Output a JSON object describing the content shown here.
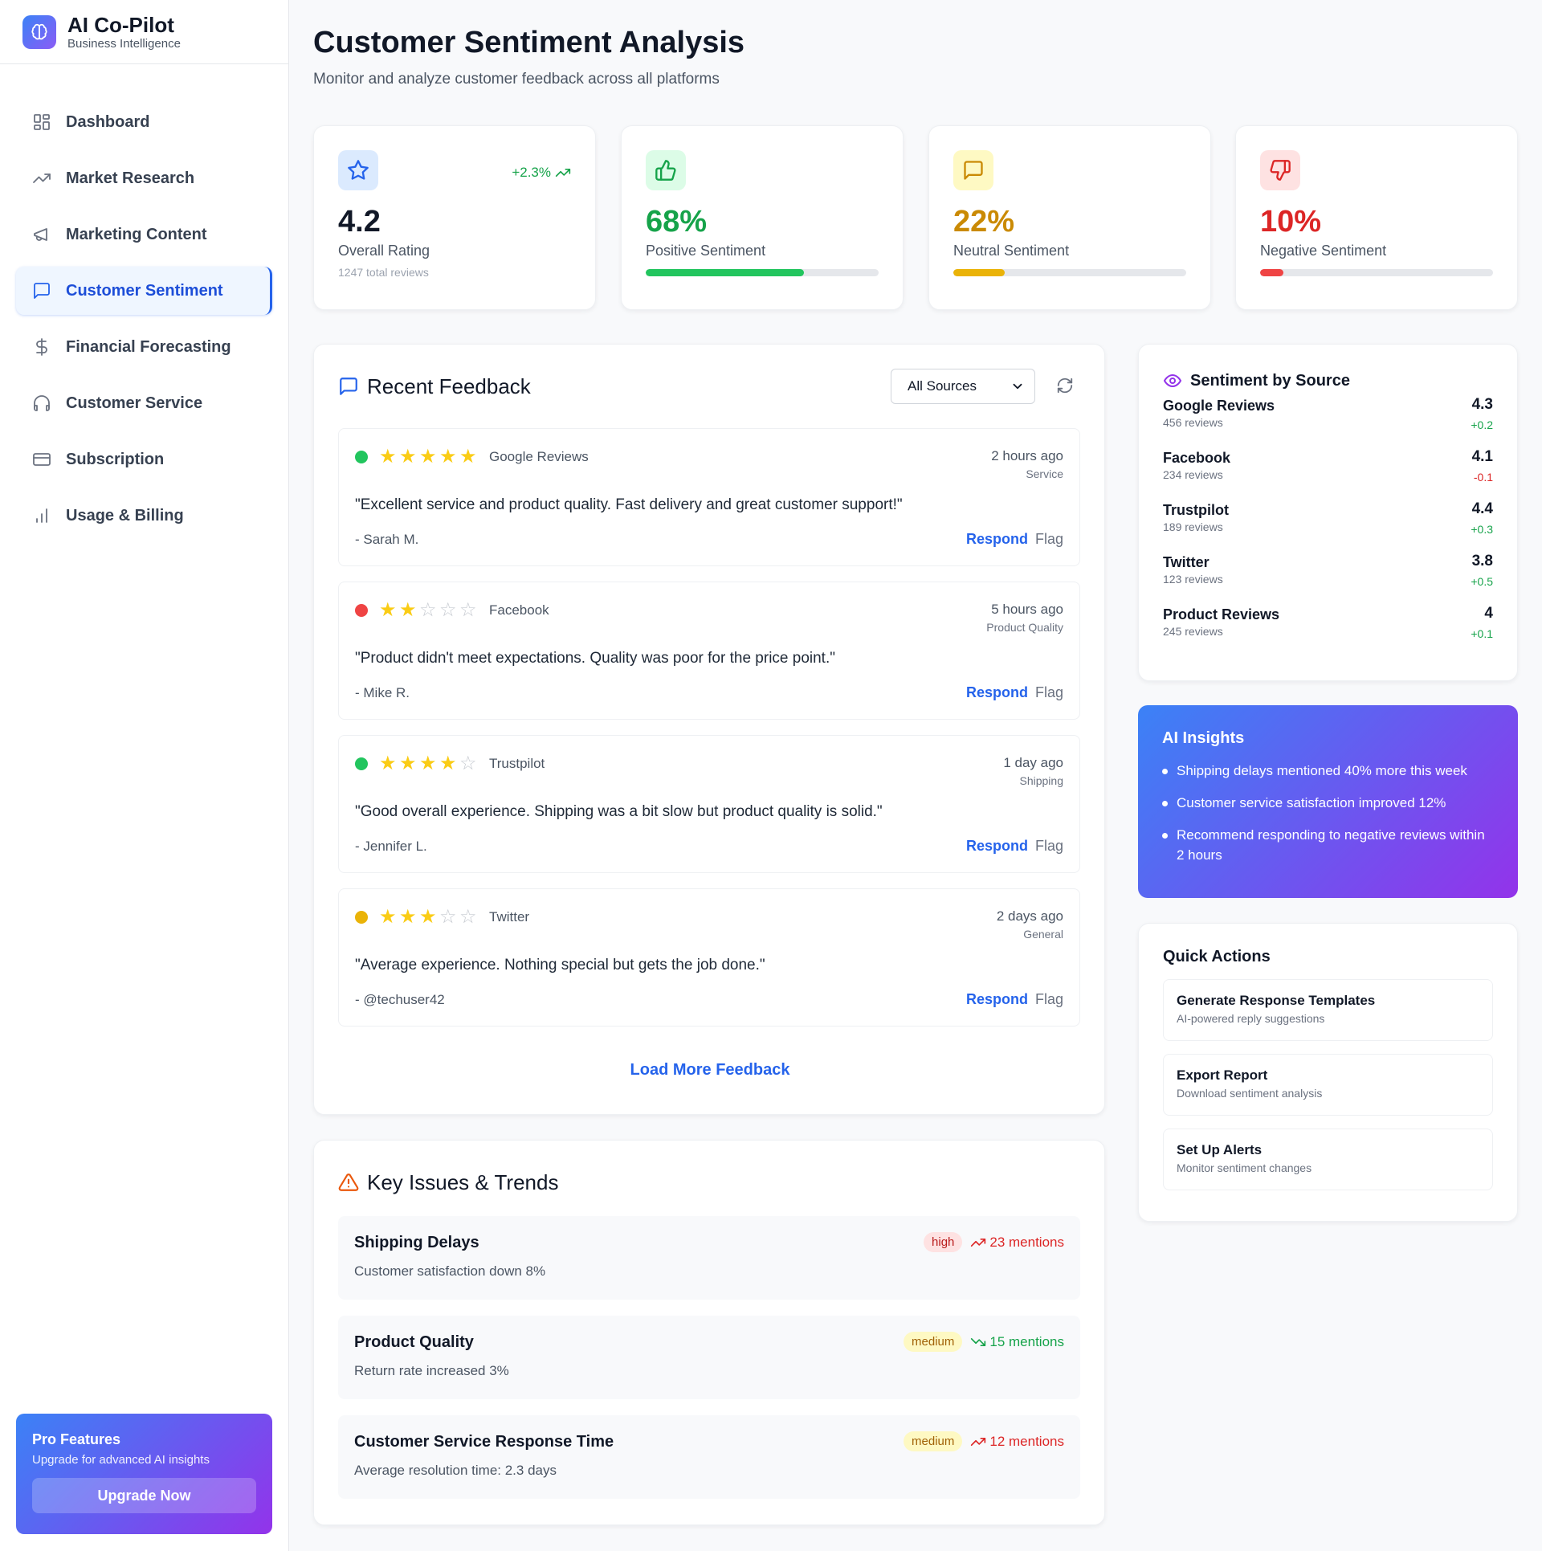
{
  "app": {
    "title": "AI Co-Pilot",
    "subtitle": "Business Intelligence"
  },
  "sidebar": {
    "items": [
      {
        "label": "Dashboard",
        "icon": "grid-icon"
      },
      {
        "label": "Market Research",
        "icon": "trending-up-icon"
      },
      {
        "label": "Marketing Content",
        "icon": "megaphone-icon"
      },
      {
        "label": "Customer Sentiment",
        "icon": "message-icon",
        "active": true
      },
      {
        "label": "Financial Forecasting",
        "icon": "dollar-icon"
      },
      {
        "label": "Customer Service",
        "icon": "headphones-icon"
      },
      {
        "label": "Subscription",
        "icon": "credit-card-icon"
      },
      {
        "label": "Usage & Billing",
        "icon": "bar-chart-icon"
      }
    ],
    "pro": {
      "title": "Pro Features",
      "subtitle": "Upgrade for advanced AI insights",
      "button": "Upgrade Now"
    }
  },
  "page": {
    "title": "Customer Sentiment Analysis",
    "subtitle": "Monitor and analyze customer feedback across all platforms"
  },
  "stats": {
    "overall": {
      "value": "4.2",
      "label": "Overall Rating",
      "note": "1247 total reviews",
      "change": "+2.3%",
      "icon": "star-icon"
    },
    "positive": {
      "value": "68%",
      "label": "Positive Sentiment",
      "level": 0.68,
      "color": "#22c55e",
      "icon": "thumbs-up-icon"
    },
    "neutral": {
      "value": "22%",
      "label": "Neutral Sentiment",
      "level": 0.22,
      "color": "#eab308",
      "icon": "message-square-icon"
    },
    "negative": {
      "value": "10%",
      "label": "Negative Sentiment",
      "level": 0.1,
      "color": "#ef4444",
      "icon": "thumbs-down-icon"
    }
  },
  "feedback": {
    "title": "Recent Feedback",
    "filter": "All Sources",
    "load_more": "Load More Feedback",
    "respond_label": "Respond",
    "flag_label": "Flag",
    "items": [
      {
        "stars": 5,
        "dot": "#22c55e",
        "source": "Google Reviews",
        "time": "2 hours ago",
        "category": "Service",
        "text": "\"Excellent service and product quality. Fast delivery and great customer support!\"",
        "author": "- Sarah M."
      },
      {
        "stars": 2,
        "dot": "#ef4444",
        "source": "Facebook",
        "time": "5 hours ago",
        "category": "Product Quality",
        "text": "\"Product didn't meet expectations. Quality was poor for the price point.\"",
        "author": "- Mike R."
      },
      {
        "stars": 4,
        "dot": "#22c55e",
        "source": "Trustpilot",
        "time": "1 day ago",
        "category": "Shipping",
        "text": "\"Good overall experience. Shipping was a bit slow but product quality is solid.\"",
        "author": "- Jennifer L."
      },
      {
        "stars": 3,
        "dot": "#eab308",
        "source": "Twitter",
        "time": "2 days ago",
        "category": "General",
        "text": "\"Average experience. Nothing special but gets the job done.\"",
        "author": "- @techuser42"
      }
    ]
  },
  "issues": {
    "title": "Key Issues & Trends",
    "items": [
      {
        "title": "Shipping Delays",
        "desc": "Customer satisfaction down 8%",
        "severity": "high",
        "mentions": "23 mentions",
        "trend": "up"
      },
      {
        "title": "Product Quality",
        "desc": "Return rate increased 3%",
        "severity": "medium",
        "mentions": "15 mentions",
        "trend": "down"
      },
      {
        "title": "Customer Service Response Time",
        "desc": "Average resolution time: 2.3 days",
        "severity": "medium",
        "mentions": "12 mentions",
        "trend": "up"
      }
    ]
  },
  "sources": {
    "title": "Sentiment by Source",
    "items": [
      {
        "name": "Google Reviews",
        "count": "456 reviews",
        "rating": "4.3",
        "change": "+0.2"
      },
      {
        "name": "Facebook",
        "count": "234 reviews",
        "rating": "4.1",
        "change": "-0.1"
      },
      {
        "name": "Trustpilot",
        "count": "189 reviews",
        "rating": "4.4",
        "change": "+0.3"
      },
      {
        "name": "Twitter",
        "count": "123 reviews",
        "rating": "3.8",
        "change": "+0.5"
      },
      {
        "name": "Product Reviews",
        "count": "245 reviews",
        "rating": "4",
        "change": "+0.1"
      }
    ]
  },
  "insights": {
    "title": "AI Insights",
    "items": [
      "Shipping delays mentioned 40% more this week",
      "Customer service satisfaction improved 12%",
      "Recommend responding to negative reviews within 2 hours"
    ]
  },
  "quick_actions": {
    "title": "Quick Actions",
    "items": [
      {
        "name": "Generate Response Templates",
        "desc": "AI-powered reply suggestions"
      },
      {
        "name": "Export Report",
        "desc": "Download sentiment analysis"
      },
      {
        "name": "Set Up Alerts",
        "desc": "Monitor sentiment changes"
      }
    ]
  }
}
